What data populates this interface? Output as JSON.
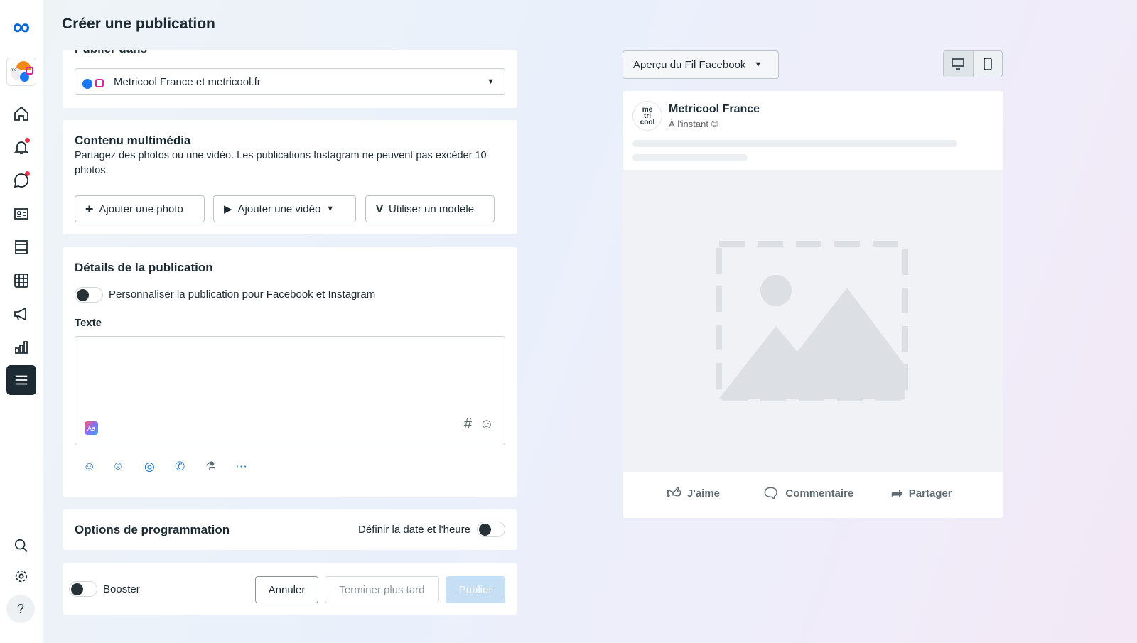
{
  "header": {
    "title": "Créer une publication"
  },
  "publish_in": {
    "label": "Publier dans",
    "account": "Metricool France et metricool.fr"
  },
  "media": {
    "title": "Contenu multimédia",
    "description": "Partagez des photos ou une vidéo. Les publications Instagram ne peuvent pas excéder 10 photos.",
    "add_photo": "Ajouter une photo",
    "add_video": "Ajouter une vidéo",
    "use_template": "Utiliser un modèle"
  },
  "details": {
    "title": "Détails de la publication",
    "customize_label": "Personnaliser la publication pour Facebook et Instagram",
    "customize_on": false,
    "text_label": "Texte",
    "text_value": ""
  },
  "schedule": {
    "title": "Options de programmation",
    "set_date_label": "Définir la date et l'heure",
    "set_date_on": false
  },
  "footer": {
    "boost_label": "Booster",
    "boost_on": false,
    "cancel": "Annuler",
    "finish_later": "Terminer plus tard",
    "publish": "Publier"
  },
  "preview": {
    "mode": "Aperçu du Fil Facebook",
    "page_name": "Metricool France",
    "time": "À l'instant",
    "avatar_text": "me tri cool",
    "like": "J'aime",
    "comment": "Commentaire",
    "share": "Partager"
  },
  "colors": {
    "accent": "#0064e0",
    "notification": "#e0334a",
    "publish_disabled": "#c6dff5"
  }
}
